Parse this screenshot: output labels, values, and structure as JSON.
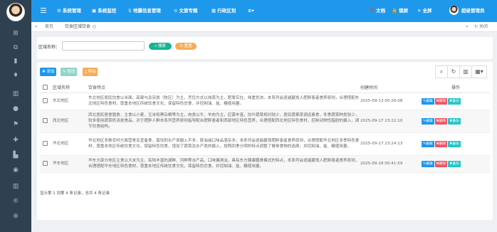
{
  "sidebar": {
    "icons": [
      "grid-icon",
      "cube-icon",
      "book-icon",
      "pin-icon",
      "bar-chart-icon",
      "circle-icon",
      "flag-icon",
      "plus-move-icon",
      "column-chart-icon",
      "circle-dot-icon",
      "bar-chart-2-icon",
      "registered-icon",
      "target-icon"
    ]
  },
  "topbar": {
    "menu_system": "系统管理",
    "menu_monitor": "系统监控",
    "menu_geo": "地震信息管理",
    "menu_culture": "文旅专题",
    "menu_region": "行政区划",
    "menu_more": "≡▾",
    "docs": "文档",
    "lock": "锁屏",
    "fullscreen": "全屏",
    "user": "超级管理员"
  },
  "tabs": {
    "home": "首页",
    "active": "饮食区域饮食",
    "close_all": "关闭"
  },
  "search": {
    "label": "区域名称：",
    "input_value": "",
    "search_btn": "搜索",
    "reset_btn": "重置"
  },
  "toolbar": {
    "add": "添加",
    "edit": "修改",
    "export": "导出"
  },
  "table": {
    "headers": [
      "区域名称",
      "饮食特点",
      "创建时间",
      "操作"
    ],
    "op_edit": "编辑",
    "op_delete": "删除",
    "op_backup": "备份",
    "rows": [
      {
        "name": "东北地区",
        "desc": "东北地区居民饮食以米面、高粱与及另类（牧区）为主，烹饪方式以炖菜为主，肥厚实在，味重色浓。本系列会逐遍赢饱人肥胖患者食养原则，合理搭配东北地区特色食材，尊重本地区传统饮食文化，保留特色饮食，并控制油、盐、糖使用量。",
        "time": "2025-09-13 00:26:08"
      },
      {
        "name": "西北地区",
        "desc": "西北居民居食圆食，主食以小麦、玉米和黑杂粮等为主，肉类以牛、羊肉为主，应需丰富，饮叶蔬菜相对较少，居民蔬果菜调运素食，冬季蔬菜种类较少，较多使用蔬菜奶汤类食品，对于肥胖人群本系列营养原则指导配合肥胖患者和西部地区特色营养，合理搭配西北地区特色食材，控制动物性脂肪的摄入，调节饮食结构。",
        "time": "2025-09-17 23:22:10"
      },
      {
        "name": "华北地区",
        "desc": "华北地区多数农村方面营食及宣备食，喜饮刺水产类摄入不多，厚油减口味品混杂多；本系列会逐遍赢饱肥胖患者食养原则，合理搭配华北地区多季特色食材，尊重本地区传统饮食文化，保留特色饮食，增加了蔬菜及水产类的摄入，按照四季分明的特点调整了餐单食物的选择，并控制油、盐、糖使用量。",
        "time": "2025-09-17 23:24:13"
      },
      {
        "name": "华东地区",
        "desc": "华东大部分地区主食以大米为主，有陆丰富的湖鲜、河鲜等水产品，口味偏清淡，具有东方健康膳食模式的特点，本系列会逐遍赢饱人肥胖患者食养原则，合理搭配华东地区特色食材，尊重本地区传统饮食文化，保留特色饮食，并控制油、盐、糖使用量。",
        "time": "2025-09-18 00:41:59"
      }
    ],
    "footer": "显示第 1 到第 4 条记录，总共 4 条记录"
  },
  "colors": {
    "topbar": "#1e98ea",
    "sidebar": "#2f4050",
    "primary": "#1e98ea",
    "success": "#1ab394",
    "warning": "#f8ac59",
    "danger": "#ed5565",
    "info": "#23c6c8"
  }
}
